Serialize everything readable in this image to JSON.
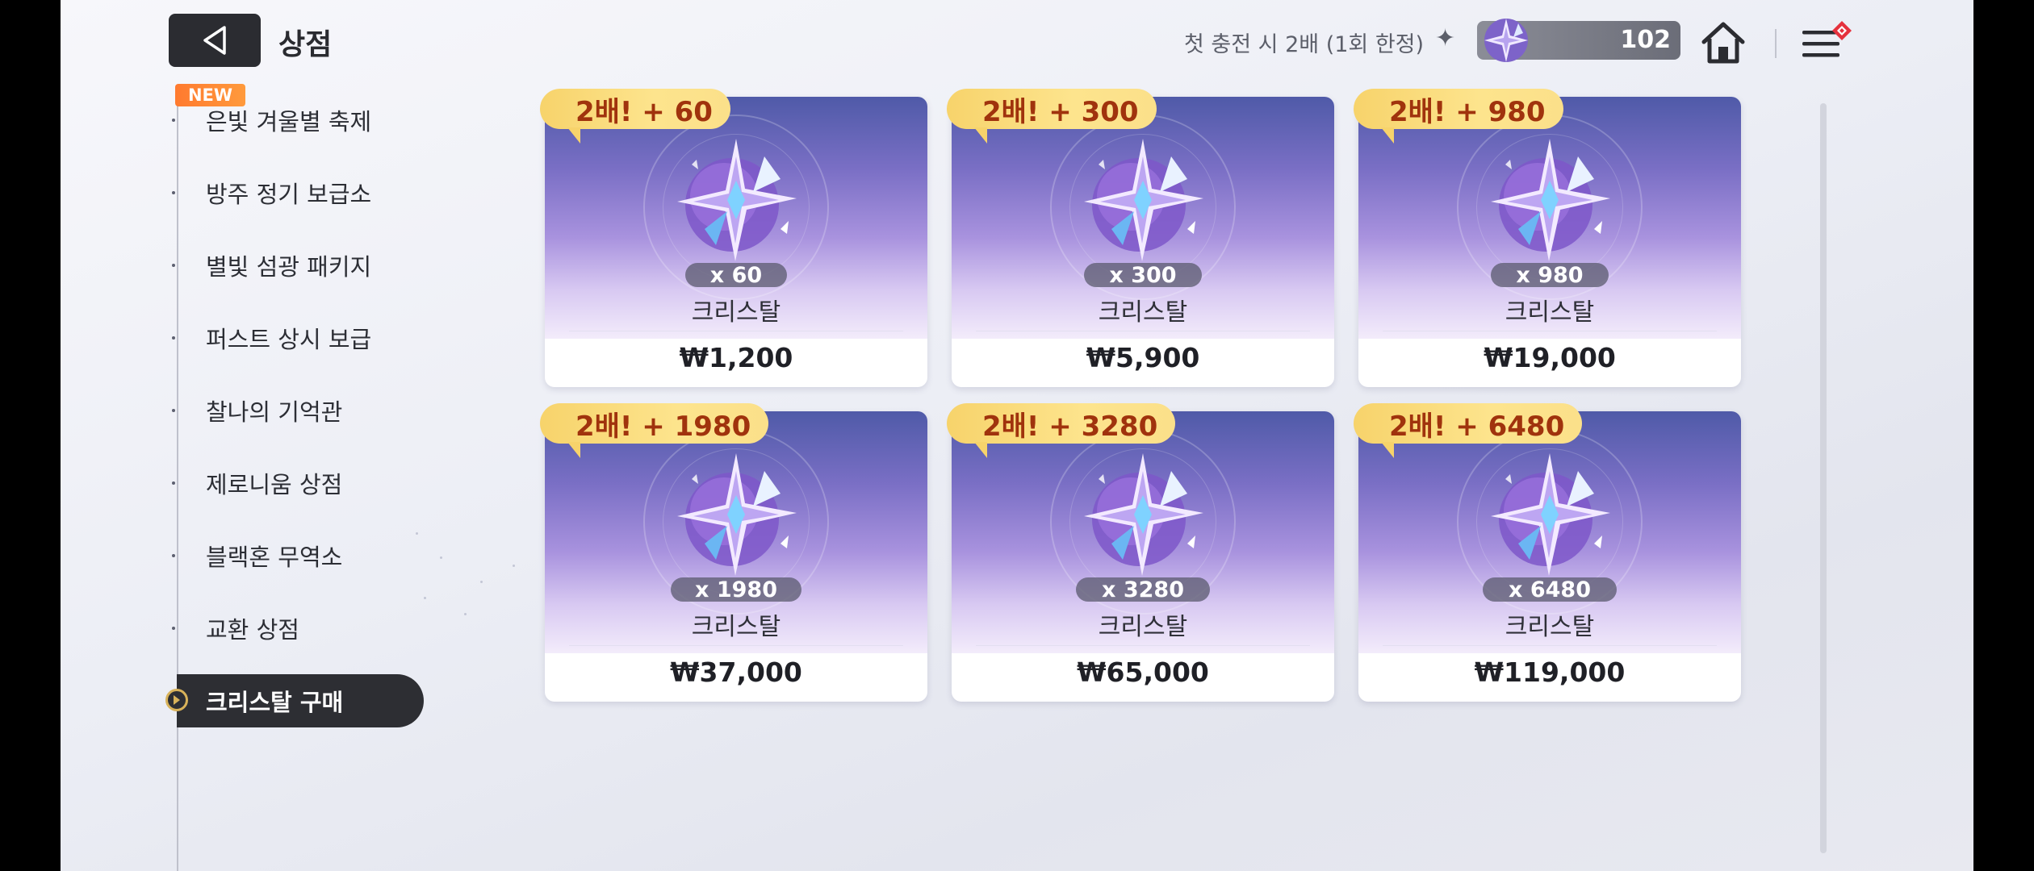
{
  "header": {
    "title": "상점",
    "promo_text": "첫 충전 시 2배 (1회 한정)",
    "promo_icon": "sparkle-icon",
    "currency_value": "102"
  },
  "sidebar": {
    "new_badge": "NEW",
    "items": [
      {
        "label": "은빛 겨울별 축제"
      },
      {
        "label": "방주 정기 보급소"
      },
      {
        "label": "별빛 섬광 패키지"
      },
      {
        "label": "퍼스트 상시 보급"
      },
      {
        "label": "찰나의 기억관"
      },
      {
        "label": "제로니움 상점"
      },
      {
        "label": "블랙혼 무역소"
      },
      {
        "label": "교환 상점"
      },
      {
        "label": "크리스탈 구매"
      }
    ],
    "active_index": 8
  },
  "products": [
    {
      "bonus": "2배! + 60",
      "quantity": "x 60",
      "name": "크리스탈",
      "price": "₩1,200"
    },
    {
      "bonus": "2배! + 300",
      "quantity": "x 300",
      "name": "크리스탈",
      "price": "₩5,900"
    },
    {
      "bonus": "2배! + 980",
      "quantity": "x 980",
      "name": "크리스탈",
      "price": "₩19,000"
    },
    {
      "bonus": "2배! + 1980",
      "quantity": "x 1980",
      "name": "크리스탈",
      "price": "₩37,000"
    },
    {
      "bonus": "2배! + 3280",
      "quantity": "x 3280",
      "name": "크리스탈",
      "price": "₩65,000"
    },
    {
      "bonus": "2배! + 6480",
      "quantity": "x 6480",
      "name": "크리스탈",
      "price": "₩119,000"
    }
  ],
  "colors": {
    "accent_dark": "#2d2e33",
    "bonus_gold": "#f7d36b",
    "bonus_text": "#a0330d",
    "new_badge": "#ff7a2f"
  }
}
